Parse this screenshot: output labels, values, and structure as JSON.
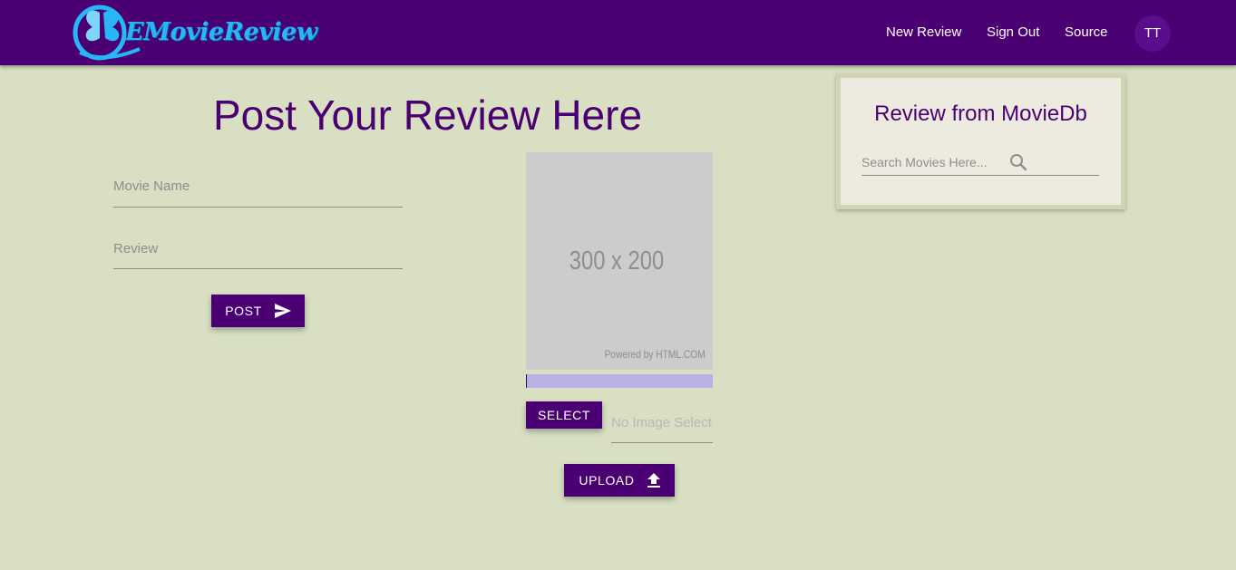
{
  "header": {
    "logo_text": "EMovieReview",
    "nav": [
      "New Review",
      "Sign Out",
      "Source"
    ],
    "avatar_initials": "TT"
  },
  "form": {
    "title": "Post Your Review Here",
    "movie_name_placeholder": "Movie Name",
    "review_placeholder": "Review",
    "post_label": "POST"
  },
  "upload": {
    "placeholder_dims": "300 x 200",
    "placeholder_powered": "Powered by HTML.COM",
    "progress_percent": 0,
    "select_label": "SELECT",
    "file_status": "No Image Selected",
    "upload_label": "UPLOAD"
  },
  "moviedb": {
    "title": "Review from MovieDb",
    "search_placeholder": "Search Movies Here..."
  },
  "colors": {
    "primary": "#4a0072",
    "background": "#d8dfc2",
    "card": "#edeae0",
    "logo_accent": "#29b6f6",
    "progress_track": "#b9b1e6"
  }
}
